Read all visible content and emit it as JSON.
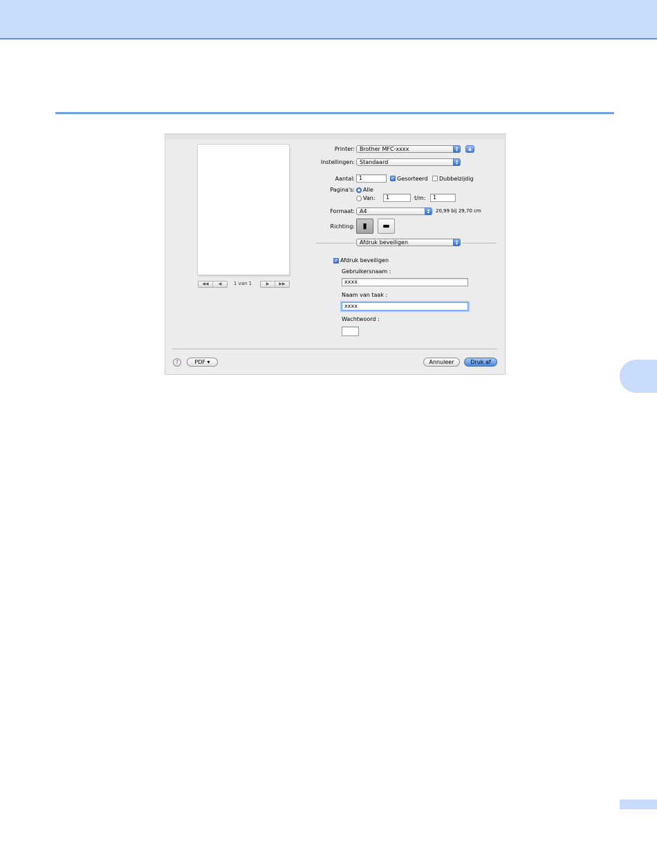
{
  "page": {
    "colors": {
      "band": "#c9dbfa",
      "rule": "#6fa0ea",
      "accent": "#3a79d8"
    }
  },
  "preview": {
    "prev_icons": [
      "◀◀",
      "◀"
    ],
    "next_icons": [
      "▶",
      "▶▶"
    ],
    "page_count": "1 van 1"
  },
  "form": {
    "printer": {
      "label": "Printer:",
      "value": "Brother MFC-xxxx",
      "expand_icon": "disclosure-up-icon"
    },
    "settings": {
      "label": "Instellingen:",
      "value": "Standaard"
    },
    "copies": {
      "label": "Aantal:",
      "value": "1",
      "collated_label": "Gesorteerd",
      "collated_checked": true,
      "duplex_label": "Dubbelzijdig",
      "duplex_checked": false
    },
    "pages": {
      "label": "Pagina's:",
      "all_label": "Alle",
      "from_label": "Van:",
      "from_value": "1",
      "to_label": "t/m:",
      "to_value": "1",
      "selected": "all"
    },
    "paper_size": {
      "label": "Formaat:",
      "value": "A4",
      "dimensions": "20,99 bij 29,70 cm"
    },
    "orientation": {
      "label": "Richting:",
      "selected": "portrait",
      "portrait_icon": "portrait-orientation-icon",
      "landscape_icon": "landscape-orientation-icon"
    },
    "panel_menu": {
      "value": "Afdruk beveiligen"
    }
  },
  "secure": {
    "enable_label": "Afdruk beveiligen",
    "enable_checked": true,
    "username_label": "Gebruikersnaam :",
    "username_value": "xxxx",
    "jobname_label": "Naam van taak :",
    "jobname_value": "xxxx",
    "password_label": "Wachtwoord :",
    "password_value": ""
  },
  "footer": {
    "help": "?",
    "pdf_label": "PDF ▾",
    "cancel_label": "Annuleer",
    "print_label": "Druk af"
  }
}
